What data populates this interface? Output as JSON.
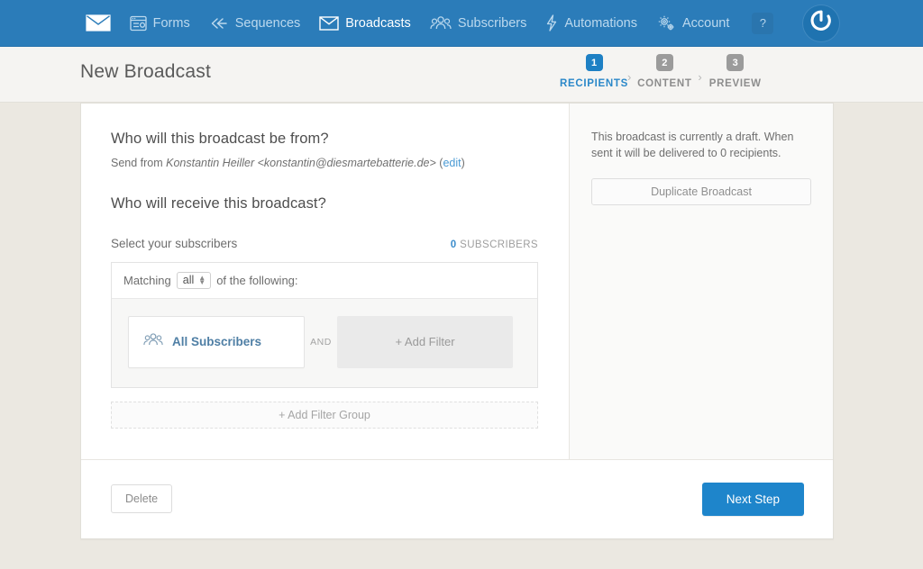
{
  "navbar": {
    "home_icon": "envelope-icon",
    "items": [
      {
        "label": "Forms",
        "icon": "forms-window-icon",
        "active": false
      },
      {
        "label": "Sequences",
        "icon": "rewind-arrow-icon",
        "active": false
      },
      {
        "label": "Broadcasts",
        "icon": "envelope-icon",
        "active": true
      },
      {
        "label": "Subscribers",
        "icon": "people-group-icon",
        "active": false
      },
      {
        "label": "Automations",
        "icon": "lightning-bolt-icon",
        "active": false
      },
      {
        "label": "Account",
        "icon": "gears-icon",
        "active": false
      }
    ],
    "help_label": "?",
    "logo_icon": "power-logo-icon",
    "bg_color": "#2b7cb9"
  },
  "header": {
    "title": "New Broadcast",
    "steps": [
      {
        "number": "1",
        "label": "RECIPIENTS",
        "active": true
      },
      {
        "number": "2",
        "label": "CONTENT",
        "active": false
      },
      {
        "number": "3",
        "label": "PREVIEW",
        "active": false
      }
    ],
    "separator": "›"
  },
  "main": {
    "from_heading": "Who will this broadcast be from?",
    "send_from_prefix": "Send from ",
    "send_from_identity": "Konstantin Heiller <konstantin@diesmartebatterie.de>",
    "edit_open_paren": " (",
    "edit_link": "edit",
    "edit_close_paren": ")",
    "receive_heading": "Who will receive this broadcast?",
    "select_subscribers_label": "Select your subscribers",
    "subscriber_count": "0",
    "subscriber_count_label": "SUBSCRIBERS",
    "matching_prefix": "Matching",
    "matching_value": "all",
    "matching_suffix": "of the following:",
    "filter_tile_label": "All Subscribers",
    "filter_tile_icon": "people-group-icon",
    "conjunction": "AND",
    "add_filter_label": "+ Add Filter",
    "add_filter_group_label": "+ Add Filter Group"
  },
  "sidebar": {
    "draft_text": "This broadcast is currently a draft. When sent it will be delivered to 0 recipients.",
    "duplicate_label": "Duplicate Broadcast"
  },
  "footer": {
    "delete_label": "Delete",
    "next_label": "Next Step",
    "next_color": "#1e85cb"
  }
}
